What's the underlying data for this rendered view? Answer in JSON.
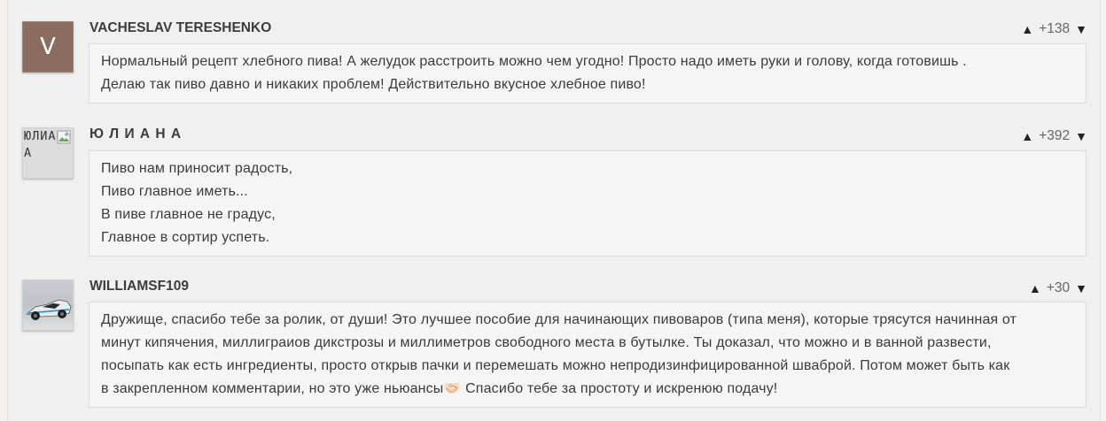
{
  "comments": [
    {
      "author": "VACHESLAV TERESHENKO",
      "avatar": {
        "type": "letter",
        "letter": "V",
        "color": "#8b6d60"
      },
      "score": "+138",
      "lines": [
        "Нормальный рецепт хлебного пива! А желудок расстроить можно чем угодно! Просто надо иметь руки и голову, когда готовишь .",
        "Делаю так пиво давно и никаких проблем! Действительно вкусное хлебное пиво!"
      ]
    },
    {
      "author": "Ю Л И А Н А",
      "avatar": {
        "type": "broken-image",
        "alt": "ЮЛИАНА",
        "icon": "broken-image-icon"
      },
      "score": "+392",
      "lines": [
        "Пиво нам приносит радость,",
        "Пиво главное иметь...",
        "В пиве главное не градус,",
        "Главное в сортир успеть."
      ]
    },
    {
      "author": "WILLIAMSF109",
      "avatar": {
        "type": "photo",
        "subject": "race-car"
      },
      "score": "+30",
      "lines": [
        "Дружище, спасибо тебе за ролик, от души! Это лучшее пособие для начинающих пивоваров (типа меня), которые трясутся начинная от",
        "минут кипячения, миллиграиов дикстрозы и миллиметров свободного места в бутылке. Ты доказал, что можно и в ванной развести,",
        "посыпать как есть ингредиенты, просто открыв пачки и перемешать можно непродизинфицированной шваброй. Потом может быть как",
        "в закрепленном комментарии, но это уже ньюансы🤝🏻 Спасибо тебе за простоту и искренюю подачу!"
      ]
    }
  ],
  "icons": {
    "upvote": "▲",
    "downvote": "▼"
  }
}
